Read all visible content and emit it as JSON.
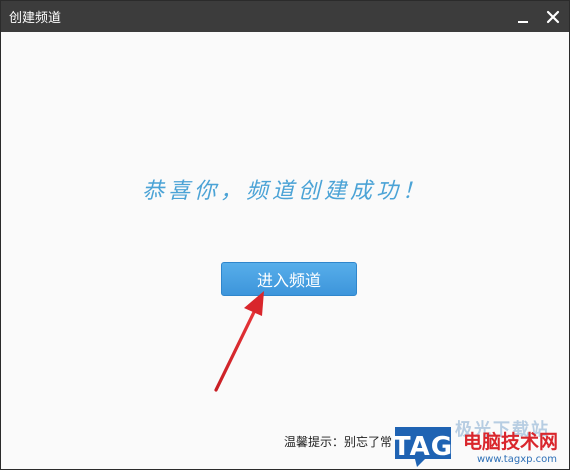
{
  "window": {
    "title": "创建频道"
  },
  "main": {
    "congrats_text": "恭喜你，频道创建成功！",
    "enter_button_label": "进入频道",
    "tip_text": "温馨提示：别忘了常"
  },
  "watermark": {
    "logo_text": "TAG",
    "site_name": "电脑技术网",
    "url": "www.tagxp.com",
    "faded_text": "极光下载站"
  },
  "colors": {
    "titlebar": "#3c3c3c",
    "accent_blue": "#4ba3d6",
    "button_blue": "#3d95db",
    "arrow_red": "#d9262c",
    "logo_blue": "#1f63b3"
  },
  "icons": {
    "minimize": "minimize-icon",
    "close": "close-icon",
    "arrow": "red-arrow-annotation"
  }
}
